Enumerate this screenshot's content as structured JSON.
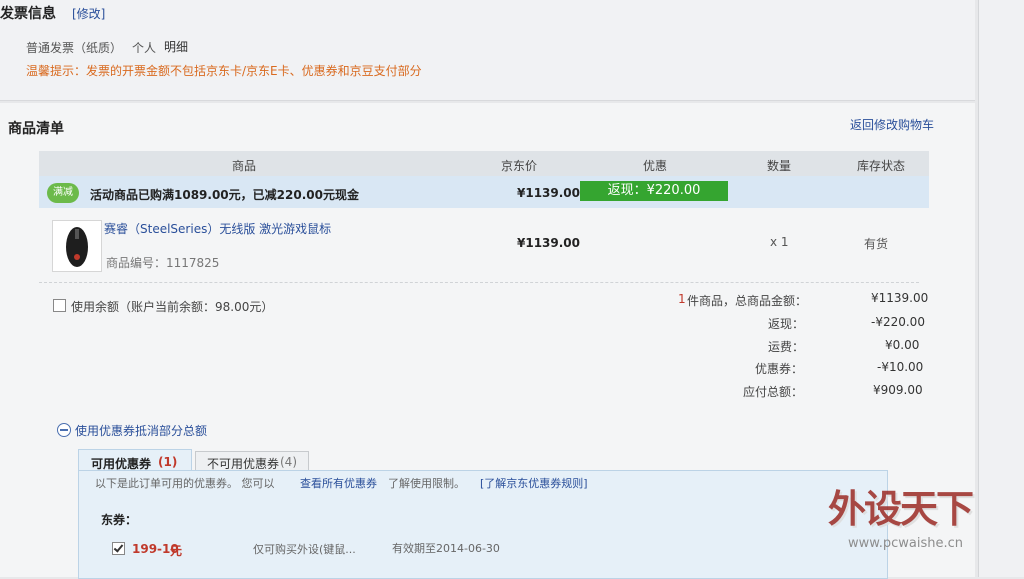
{
  "invoice": {
    "title": "发票信息",
    "edit_link": "[修改]",
    "type": "普通发票（纸质）",
    "person": "个人",
    "detail": "明细",
    "tip": "温馨提示：发票的开票金额不包括京东卡/京东E卡、优惠券和京豆支付部分"
  },
  "list": {
    "title": "商品清单",
    "back_link": "返回修改购物车",
    "headers": [
      "商品",
      "京东价",
      "优惠",
      "数量",
      "库存状态"
    ],
    "promo_badge": "满减",
    "promo_text": "活动商品已购满1089.00元，已减220.00元现金",
    "promo_price": "¥1139.00",
    "promo_discount": "返现：¥220.00",
    "item": {
      "name": "赛睿（SteelSeries）无线版 激光游戏鼠标",
      "sku": "商品编号：1117825",
      "price": "¥1139.00",
      "qty": "x 1",
      "stock": "有货"
    }
  },
  "balance_label": "使用余额（账户当前余额：98.00元）",
  "summary": {
    "count_num": "1",
    "count_label": "件商品，总商品金额：",
    "total": "¥1139.00",
    "rebate_label": "返现：",
    "rebate": "-¥220.00",
    "shipping_label": "运费：",
    "shipping": "¥0.00",
    "coupon_label": "优惠券：",
    "coupon": "-¥10.00",
    "payable_label": "应付总额：",
    "payable": "¥909.00"
  },
  "coupon": {
    "toggle_label": "使用优惠券抵消部分总额",
    "tab_available": "可用优惠券",
    "tab_available_count": "(1)",
    "tab_unavailable": "不可用优惠券",
    "tab_unavailable_count": "(4)",
    "hint": "以下是此订单可用的优惠券。 您可以",
    "view_all_link": "查看所有优惠券",
    "hint_tail": "了解使用限制。",
    "rules_link": "[了解京东优惠券规则]",
    "section": "东券：",
    "row": {
      "value": "199-10",
      "unit": "元",
      "scope": "仅可购买外设(键鼠...",
      "expiry": "有效期至2014-06-30"
    }
  },
  "watermark": {
    "brand": "外设天下",
    "url": "www.pcwaishe.cn"
  }
}
